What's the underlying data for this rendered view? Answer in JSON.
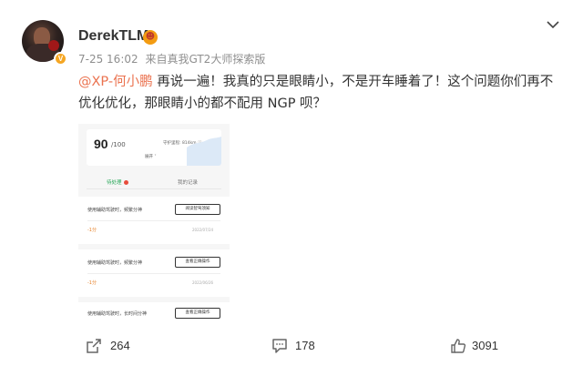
{
  "post": {
    "author": "DerekTLM",
    "time": "7-25 16:02",
    "source_prefix": "来自",
    "source": "真我GT2大师探索版",
    "mention": "@XP-何小鹏",
    "text": " 再说一遍！我真的只是眼睛小，不是开车睡着了！这个问题你们再不优化优化，那眼睛小的都不配用 NGP 呗？"
  },
  "screenshot": {
    "score": "90",
    "score_total": "/100",
    "guard_label": "守护里程: 814km ⓘ",
    "expand": "展开 ˅",
    "tabs": {
      "pending": "待处理",
      "records": "我的记录"
    },
    "items": [
      {
        "desc": "使用辅助驾驶时，频繁分神",
        "button": "阅读智驾须知",
        "points": "-1分",
        "date": "2022/07/24"
      },
      {
        "desc": "使用辅助驾驶时，频繁分神",
        "button": "查看正确操作",
        "points": "-1分",
        "date": "2022/06/26"
      },
      {
        "desc": "使用辅助驾驶时，长时间分神",
        "button": "查看正确操作",
        "points": "",
        "date": ""
      }
    ]
  },
  "actions": {
    "repost": "264",
    "comment": "178",
    "like": "3091"
  },
  "colors": {
    "mention": "#eb7350",
    "badge": "#f5a623",
    "green_tab": "#2aa85a"
  },
  "icons": [
    "chevron-down-icon",
    "repost-icon",
    "comment-icon",
    "like-icon",
    "verified-badge-icon"
  ]
}
